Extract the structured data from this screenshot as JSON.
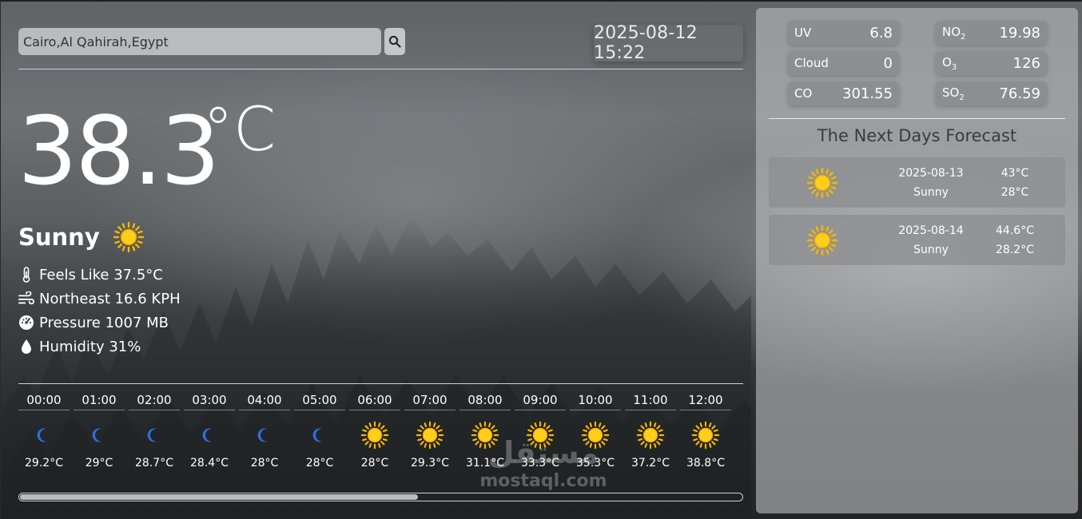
{
  "search": {
    "value": "Cairo,Al Qahirah,Egypt",
    "icon": "search-icon"
  },
  "datetime": "2025-08-12 15:22",
  "current": {
    "temperature": "38.3",
    "unit": "°C",
    "condition": "Sunny",
    "condition_icon": "sun-icon",
    "details": [
      {
        "icon": "thermometer-icon",
        "text": "Feels Like 37.5°C"
      },
      {
        "icon": "wind-icon",
        "text": "Northeast 16.6 KPH"
      },
      {
        "icon": "gauge-icon",
        "text": "Pressure 1007 MB"
      },
      {
        "icon": "droplet-icon",
        "text": "Humidity 31%"
      }
    ]
  },
  "hourly": [
    {
      "time": "00:00",
      "icon": "moon-icon",
      "temp": "29.2°C"
    },
    {
      "time": "01:00",
      "icon": "moon-icon",
      "temp": "29°C"
    },
    {
      "time": "02:00",
      "icon": "moon-icon",
      "temp": "28.7°C"
    },
    {
      "time": "03:00",
      "icon": "moon-icon",
      "temp": "28.4°C"
    },
    {
      "time": "04:00",
      "icon": "moon-icon",
      "temp": "28°C"
    },
    {
      "time": "05:00",
      "icon": "moon-icon",
      "temp": "28°C"
    },
    {
      "time": "06:00",
      "icon": "sun-icon",
      "temp": "28°C"
    },
    {
      "time": "07:00",
      "icon": "sun-icon",
      "temp": "29.3°C"
    },
    {
      "time": "08:00",
      "icon": "sun-icon",
      "temp": "31.1°C"
    },
    {
      "time": "09:00",
      "icon": "sun-icon",
      "temp": "33.3°C"
    },
    {
      "time": "10:00",
      "icon": "sun-icon",
      "temp": "35.3°C"
    },
    {
      "time": "11:00",
      "icon": "sun-icon",
      "temp": "37.2°C"
    },
    {
      "time": "12:00",
      "icon": "sun-icon",
      "temp": "38.8°C"
    }
  ],
  "hourly_scroll_fraction": 0.55,
  "air_quality": {
    "uv": {
      "label": "UV",
      "value": "6.8"
    },
    "no2": {
      "label": "NO",
      "sub": "2",
      "value": "19.98"
    },
    "cloud": {
      "label": "Cloud",
      "value": "0"
    },
    "o3": {
      "label": "O",
      "sub": "3",
      "value": "126"
    },
    "co": {
      "label": "CO",
      "value": "301.55"
    },
    "so2": {
      "label": "SO",
      "sub": "2",
      "value": "76.59"
    }
  },
  "forecast": {
    "title": "The Next Days Forecast",
    "days": [
      {
        "date": "2025-08-13",
        "condition": "Sunny",
        "max": "43°C",
        "min": "28°C",
        "icon": "sun-icon"
      },
      {
        "date": "2025-08-14",
        "condition": "Sunny",
        "max": "44.6°C",
        "min": "28.2°C",
        "icon": "sun-icon"
      }
    ]
  },
  "watermark": {
    "arabic": "مستقل",
    "latin": "mostaql.com"
  },
  "colors": {
    "sun": "#f5b800",
    "moon": "#2f6fe0",
    "panel": "#b9bbbd"
  }
}
